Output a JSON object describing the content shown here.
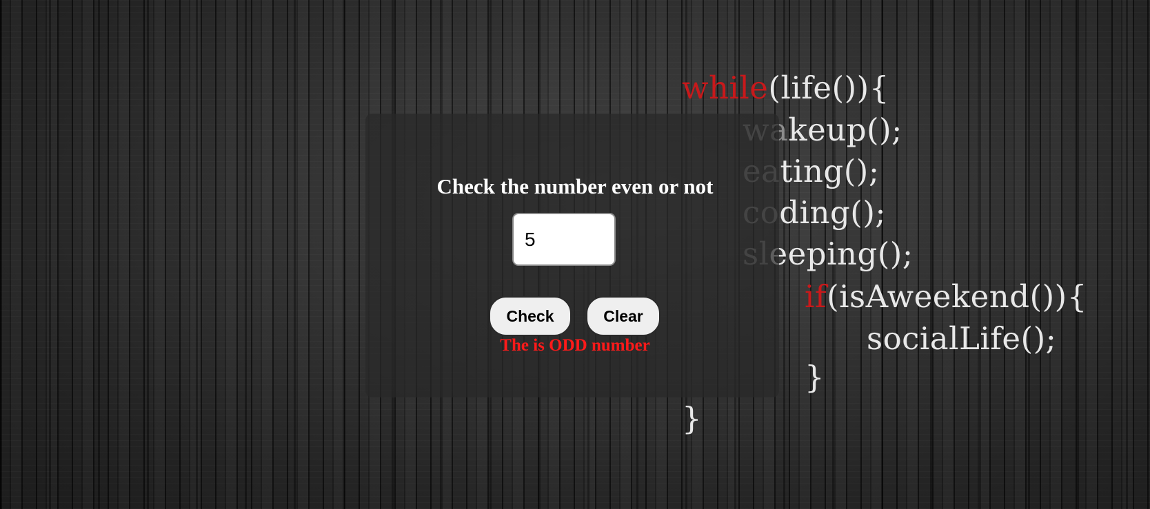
{
  "wallpaper": {
    "line1": {
      "kw": "while",
      "rest": "(life()){"
    },
    "line2": {
      "fade": "wa",
      "rest": "keup();"
    },
    "line3": {
      "fade": "ea",
      "rest": "ting();"
    },
    "line4": {
      "fade": "co",
      "rest": "ding();"
    },
    "line5": {
      "fade": "sl",
      "rest": "eeping();"
    },
    "line6": {
      "kw": "if",
      "rest": "(isAweekend()){"
    },
    "line7": "socialLife();",
    "line8": "}",
    "line9": "}"
  },
  "form": {
    "title": "Check the number even or not",
    "input_value": "5",
    "check_label": "Check",
    "clear_label": "Clear",
    "result_text": "The is ODD number"
  },
  "colors": {
    "keyword_red": "#c8191b",
    "result_red": "#ff1a1a",
    "panel": "#282828"
  }
}
